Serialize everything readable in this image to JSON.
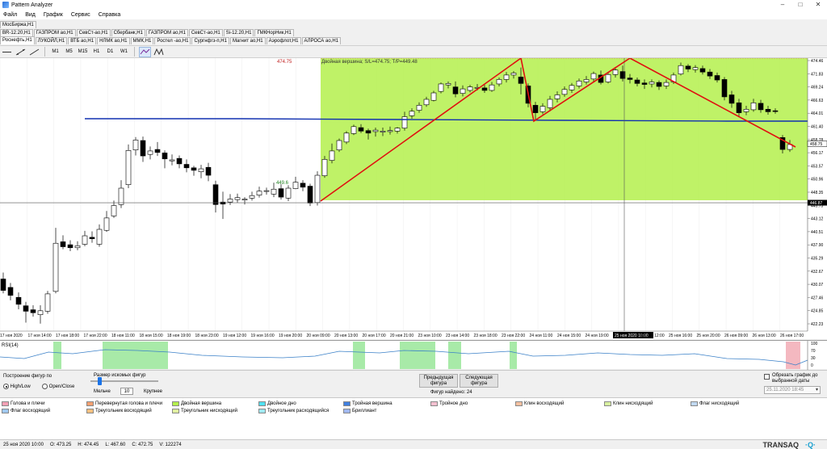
{
  "window": {
    "title": "Pattern Analyzer",
    "controls": [
      "–",
      "□",
      "✕"
    ]
  },
  "menu": [
    "Файл",
    "Вид",
    "График",
    "Сервис",
    "Справка"
  ],
  "tabs_row1": [
    "МосБиржа,H1"
  ],
  "tabs_row2": [
    "BR-12.20,H1",
    "ГАЗПРОМ ао,H1",
    "СевСт-ао,H1",
    "Сбербанк,H1",
    "ГАЗПРОМ ао,H1",
    "СевСт-ао,H1",
    "Si-12.20,H1",
    "ГМКНорНик,H1"
  ],
  "tabs_row3": [
    "Роснефть,H1",
    "ЛУКОЙЛ,H1",
    "ВТБ ао,H1",
    "НЛМК ао,H1",
    "ММК,H1",
    "Ростел -ао,H1",
    "Сургнфгз-п,H1",
    "Магнит ао,H1",
    "Аэрофлот,H1",
    "АЛРОСА ао,H1"
  ],
  "toolbar": {
    "timeframes": [
      "M1",
      "M5",
      "M15",
      "H1",
      "D1",
      "W1"
    ],
    "active_timeframe": "H1"
  },
  "chart": {
    "pattern_label": "Двойная вершина; S/L=474.75; T/P=449.48",
    "stop_label": "474.75",
    "target_label": "449.6",
    "y_ticks": [
      "474.46",
      "471.83",
      "469.24",
      "466.63",
      "464.01",
      "461.40",
      "458.78",
      "456.17",
      "453.57",
      "450.96",
      "448.35",
      "445.73",
      "443.12",
      "440.51",
      "437.90",
      "435.29",
      "432.67",
      "430.07",
      "427.46",
      "424.85",
      "422.23"
    ],
    "current_price": "458.75",
    "crosshair_price": "446.87",
    "x_ticks": [
      "17 ноя 2020",
      "17 ноя 14:00",
      "17 ноя 18:00",
      "17 ноя 22:00",
      "18 ноя 11:00",
      "18 ноя 15:00",
      "18 ноя 19:00",
      "18 ноя 23:00",
      "19 ноя 12:00",
      "19 ноя 16:00",
      "19 ноя 20:00",
      "20 ноя 09:00",
      "20 ноя 13:00",
      "20 ноя 17:00",
      "20 ноя 21:00",
      "23 ноя 10:00",
      "23 ноя 14:00",
      "23 ноя 18:00",
      "23 ноя 22:00",
      "24 ноя 11:00",
      "24 ноя 15:00",
      "24 ноя 19:00",
      "25 ноя 2020 10:00",
      "25 ноя 12:00",
      "25 ноя 16:00",
      "25 ноя 20:00",
      "26 ноя 09:00",
      "26 ноя 13:00",
      "26 ноя 17:00"
    ],
    "crosshair_time": "25 ноя 2020 10:00",
    "colors": {
      "pattern_fill": "#b4f04c",
      "pattern_line": "#e01010",
      "ma_line": "#1030b0",
      "bull": "#ffffff",
      "bear": "#000000"
    }
  },
  "rsi": {
    "label": "RSI(14)",
    "ticks": [
      "100",
      "70",
      "30",
      "0"
    ]
  },
  "controls": {
    "build_on_label": "Построение фигур по",
    "high_low": "High/Low",
    "open_close": "Open/Close",
    "size_label": "Размер искомых фигур",
    "smaller": "Мельче",
    "size_value": "10",
    "larger": "Крупнее",
    "prev_button": "Предыдущая фигура",
    "next_button": "Следующая фигура",
    "found_label": "Фигур найдено: 24",
    "trim_label": "Обрезать график до выбранной даты",
    "trim_date": "25.11.2020 18:45"
  },
  "legend": [
    {
      "label": "Голова и плечи",
      "color": "#f4a0b4"
    },
    {
      "label": "Перевернутая голова и плечи",
      "color": "#f4a070"
    },
    {
      "label": "Двойная вершина",
      "color": "#b4f04c"
    },
    {
      "label": "Двойное дно",
      "color": "#50e0f0"
    },
    {
      "label": "Тройная вершина",
      "color": "#4080e0"
    },
    {
      "label": "Тройное дно",
      "color": "#f4c0d0"
    },
    {
      "label": "Клин восходящий",
      "color": "#f4c0a0"
    },
    {
      "label": "Клин нисходящий",
      "color": "#d8f0a0"
    },
    {
      "label": "Флаг восходящий",
      "color": "#a0c8f0"
    },
    {
      "label": "Треугольник восходящий",
      "color": "#f4c080"
    },
    {
      "label": "Треугольник нисходящий",
      "color": "#e0f0a0"
    },
    {
      "label": "Треугольник расходящийся",
      "color": "#a0e8f0"
    },
    {
      "label": "Бриллиант",
      "color": "#a0b8f0"
    },
    {
      "label": "Флаг нисходящий",
      "color": "#c0d8f0"
    }
  ],
  "status": {
    "date": "25 ноя 2020 10:00",
    "open": "O: 473.25",
    "high": "H: 474.45",
    "low": "L: 467.60",
    "close": "C: 472.75",
    "volume": "V: 122274",
    "brand": "TRANSAQ"
  }
}
